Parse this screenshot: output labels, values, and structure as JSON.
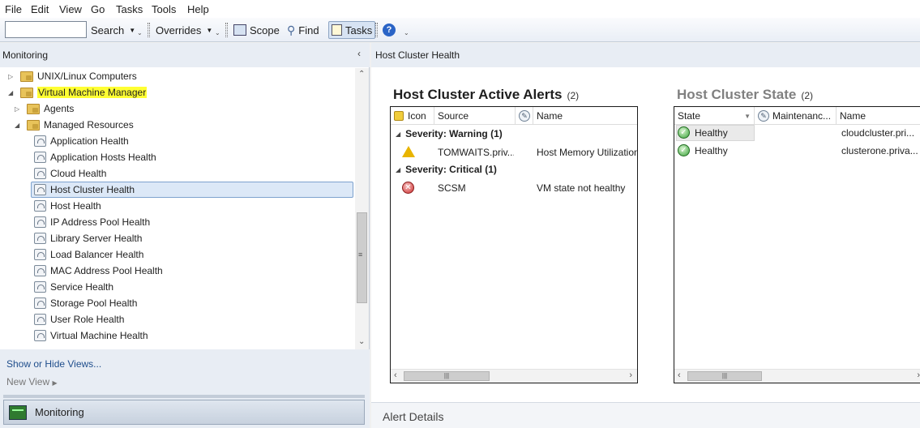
{
  "menu": [
    "File",
    "Edit",
    "View",
    "Go",
    "Tasks",
    "Tools",
    "Help"
  ],
  "toolbar": {
    "search_value": "",
    "search_label": "Search",
    "overrides_label": "Overrides",
    "scope_label": "Scope",
    "find_label": "Find",
    "tasks_label": "Tasks"
  },
  "left": {
    "title": "Monitoring",
    "tree": {
      "unix": "UNIX/Linux Computers",
      "vmm": "Virtual Machine Manager",
      "agents": "Agents",
      "managed": "Managed Resources",
      "views": [
        "Application Health",
        "Application Hosts Health",
        "Cloud Health",
        "Host Cluster Health",
        "Host Health",
        "IP Address Pool Health",
        "Library Server Health",
        "Load Balancer Health",
        "MAC Address Pool Health",
        "Service Health",
        "Storage Pool Health",
        "User Role Health",
        "Virtual Machine Health"
      ]
    },
    "show_hide": "Show or Hide Views...",
    "new_view": "New View",
    "workspace_button": "Monitoring"
  },
  "right": {
    "title": "Host Cluster Health",
    "alerts": {
      "title": "Host Cluster Active Alerts",
      "count": "(2)",
      "columns": [
        "Icon",
        "Source",
        "Name"
      ],
      "groups": [
        {
          "label": "Severity: Warning (1)",
          "rows": [
            {
              "icon": "warning-icon",
              "source": "TOMWAITS.priv...",
              "name": "Host Memory Utilization"
            }
          ]
        },
        {
          "label": "Severity: Critical (1)",
          "rows": [
            {
              "icon": "critical-icon",
              "source": "SCSM",
              "name": "VM state not healthy"
            }
          ]
        }
      ]
    },
    "state": {
      "title": "Host Cluster State",
      "count": "(2)",
      "columns": [
        "State",
        "Maintenanc...",
        "Name"
      ],
      "rows": [
        {
          "state": "Healthy",
          "name": "cloudcluster.pri..."
        },
        {
          "state": "Healthy",
          "name": "clusterone.priva..."
        }
      ]
    },
    "alert_details": "Alert Details"
  }
}
